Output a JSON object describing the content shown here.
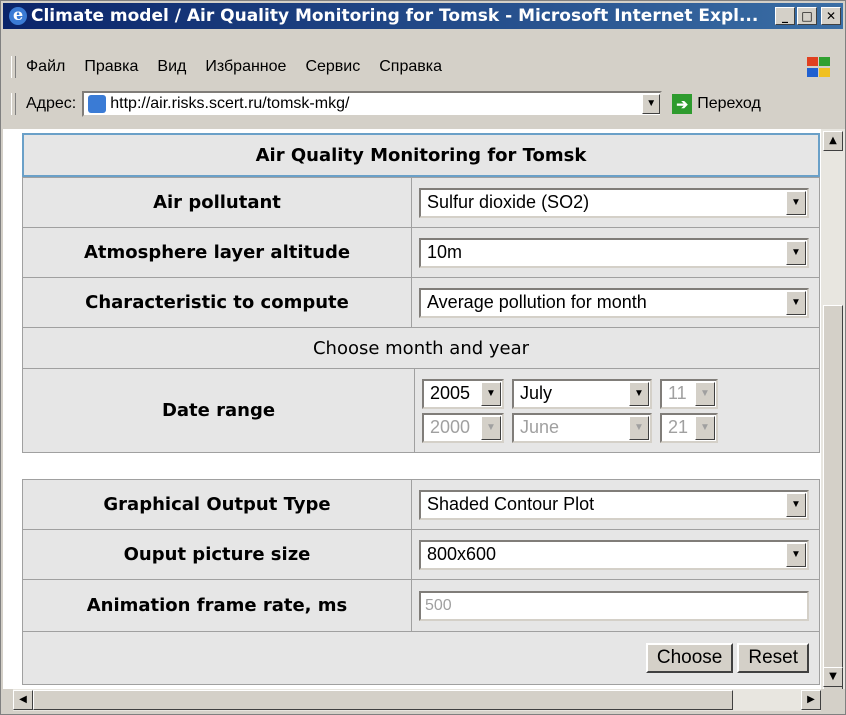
{
  "window": {
    "title": "Climate model / Air Quality Monitoring for Tomsk - Microsoft Internet Expl...",
    "controls": [
      "_",
      "□",
      "✕"
    ]
  },
  "menu": [
    "Файл",
    "Правка",
    "Вид",
    "Избранное",
    "Сервис",
    "Справка"
  ],
  "address": {
    "label": "Адрес:",
    "url": "http://air.risks.scert.ru/tomsk-mkg/",
    "go_label": "Переход"
  },
  "form": {
    "title": "Air Quality Monitoring for Tomsk",
    "pollutant": {
      "label": "Air pollutant",
      "value": "Sulfur dioxide (SO2)"
    },
    "altitude": {
      "label": "Atmosphere layer altitude",
      "value": "10m"
    },
    "characteristic": {
      "label": "Characteristic to compute",
      "value": "Average pollution for month"
    },
    "choose_note": "Choose month and year",
    "date_range": {
      "label": "Date range",
      "from": {
        "year": "2005",
        "month": "July",
        "day": "11"
      },
      "to": {
        "year": "2000",
        "month": "June",
        "day": "21"
      }
    },
    "output_type": {
      "label": "Graphical Output Type",
      "value": "Shaded Contour Plot"
    },
    "picture_size": {
      "label": "Ouput picture size",
      "value": "800x600"
    },
    "frame_rate": {
      "label": "Animation frame rate, ms",
      "value": "500"
    },
    "buttons": {
      "choose": "Choose",
      "reset": "Reset"
    }
  }
}
